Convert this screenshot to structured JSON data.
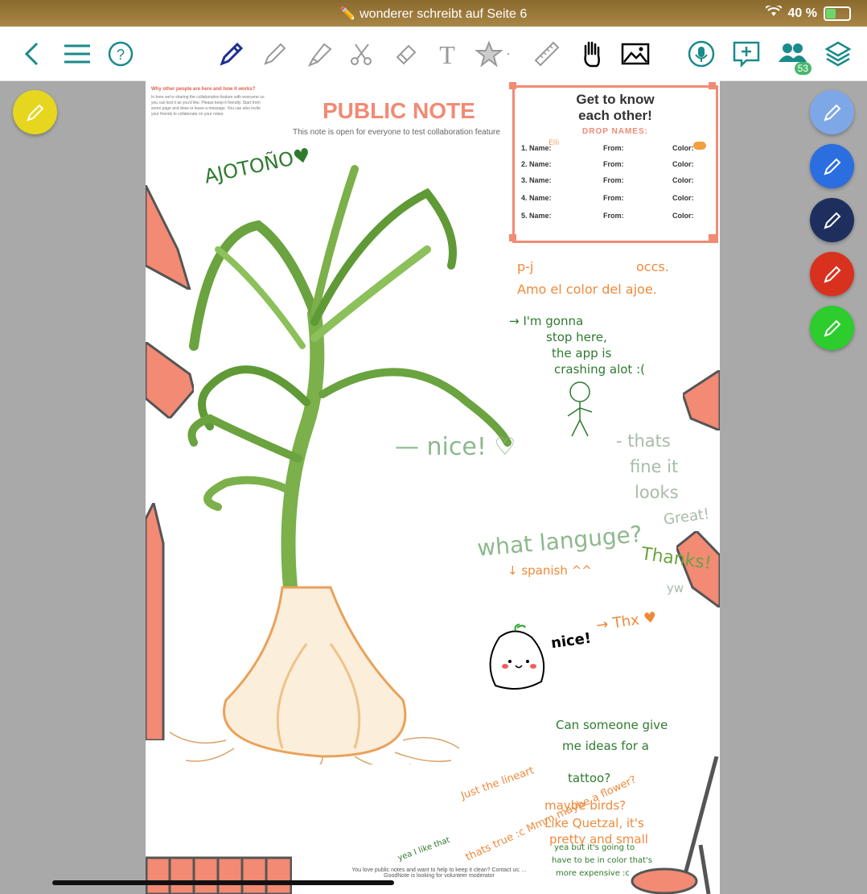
{
  "status": {
    "title": "✏️ wonderer schreibt auf Seite 6",
    "battery": "40 %"
  },
  "toolbar": {
    "collaborators_count": "53",
    "icons": [
      "back-icon",
      "menu-icon",
      "help-icon",
      "pen-icon",
      "pencil-icon",
      "highlighter-icon",
      "scissors-icon",
      "eraser-icon",
      "text-icon",
      "shapes-icon",
      "ruler-icon",
      "hand-icon",
      "image-icon",
      "microphone-icon",
      "add-comment-icon",
      "collaborators-icon",
      "layers-icon"
    ]
  },
  "page": {
    "title": "PUBLIC NOTE",
    "subtitle": "This note is open for everyone to test collaboration feature",
    "guide_heading": "Why other people are here and how it works?",
    "guide_text": "In here we're sharing the collaboration feature with everyone so you can test it as you'd like. Please keep it friendly. Start from some page and draw or leave a message. You can also invite your friends to collaborate on your notes."
  },
  "name_card": {
    "title_line1": "Get to know",
    "title_line2": "each other!",
    "drop": "DROP NAMES:",
    "rows": [
      {
        "name": "1. Name:",
        "from": "From:",
        "color": "Color:"
      },
      {
        "name": "2. Name:",
        "from": "From:",
        "color": "Color:"
      },
      {
        "name": "3. Name:",
        "from": "From:",
        "color": "Color:"
      },
      {
        "name": "4. Name:",
        "from": "From:",
        "color": "Color:"
      },
      {
        "name": "5. Name:",
        "from": "From:",
        "color": "Color:"
      }
    ],
    "entry1": "Elli"
  },
  "handwriting": {
    "ajotono": "AJOTOÑO♥",
    "pj": "p-j",
    "oces": "occs.",
    "amo": "Amo el color del ajoe.",
    "gonna1": "→ I'm gonna",
    "gonna2": "stop here,",
    "gonna3": "the app is",
    "gonna4": "crashing alot :(",
    "nice1": "— nice! ♡",
    "fine1": "- thats",
    "fine2": "fine it",
    "fine3": "looks",
    "great": "Great!",
    "language": "what languge?",
    "spanish": "↓ spanish ^^",
    "thanks": "Thanks!",
    "yw": "yw",
    "nice2": "nice!",
    "thx": "→ Thx ♥",
    "tattoo1": "Can someone give",
    "tattoo2": "me ideas for a",
    "tattoo3": "tattoo?",
    "lineart": "Just the lineart",
    "birds1": "maybe birds?",
    "birds2": "Like Quetzal, it's",
    "birds3": "pretty and small",
    "yea1": "yea but it's going to",
    "yea2": "have to be in color that's",
    "yea3": "more expensive :c",
    "flower": "thats true :c Mmm maybe a flower?",
    "like": "yea I like that"
  },
  "footer": "You love public notes and want to help to keep it clean? Contact us: ... GoodNote is looking for volunteer moderator",
  "pens": [
    {
      "color": "#7ea7e8"
    },
    {
      "color": "#2a6ee0"
    },
    {
      "color": "#1e2f5e"
    },
    {
      "color": "#d8321e"
    },
    {
      "color": "#2ccd2c"
    }
  ],
  "active_pen_color": "#e6d71e",
  "accent_color": "#1a8a8a",
  "note_accent": "#f28a74"
}
